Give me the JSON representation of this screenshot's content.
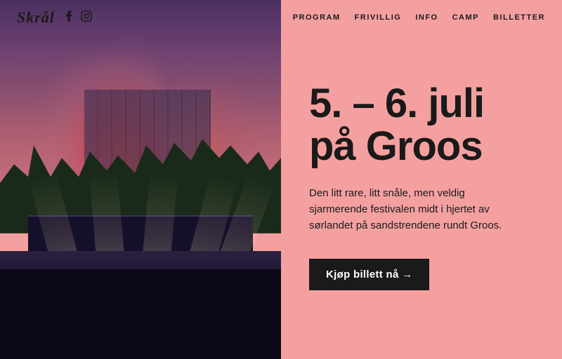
{
  "header": {
    "logo": "Skrål",
    "social": {
      "facebook_label": "f",
      "instagram_label": "⬡"
    },
    "nav": {
      "items": [
        {
          "id": "program",
          "label": "PROGRAM"
        },
        {
          "id": "frivillig",
          "label": "FRIVILLIG"
        },
        {
          "id": "info",
          "label": "INFO"
        },
        {
          "id": "camp",
          "label": "CAMP"
        },
        {
          "id": "billetter",
          "label": "BILLETTER"
        }
      ]
    }
  },
  "hero": {
    "title_line1": "5. – 6. juli",
    "title_line2": "på Groos",
    "description": "Den litt rare, litt snåle, men veldig sjarmerende festivalen midt i hjertet av sørlandet på sandstrendene rundt Groos.",
    "cta_label": "Kjøp billett nå →"
  },
  "colors": {
    "background": "#f5a0a0",
    "text_dark": "#1a1a1a",
    "button_bg": "#1a1a1a",
    "button_text": "#ffffff"
  }
}
